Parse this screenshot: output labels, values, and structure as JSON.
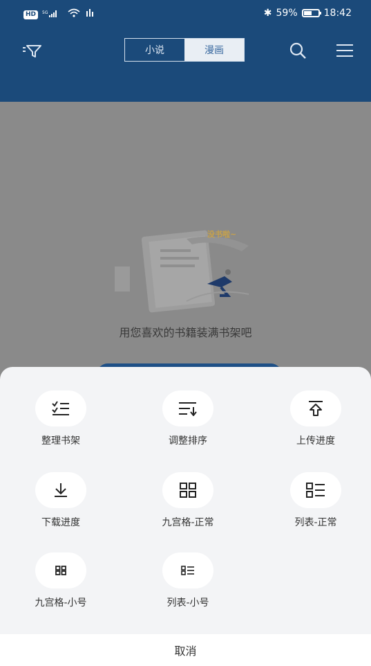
{
  "status_bar": {
    "network_badge": "HD",
    "signal_text": "5G",
    "bluetooth": "✱",
    "battery_percent": "59%",
    "battery_level": 0.59,
    "time": "18:42"
  },
  "header": {
    "tabs": [
      {
        "label": "小说",
        "selected": false
      },
      {
        "label": "漫画",
        "selected": true
      }
    ]
  },
  "empty_state": {
    "bubble_text": "没书啦~",
    "message": "用您喜欢的书籍装满书架吧"
  },
  "menu": {
    "items": [
      {
        "label": "整理书架",
        "icon": "checklist-icon"
      },
      {
        "label": "调整排序",
        "icon": "sort-icon"
      },
      {
        "label": "上传进度",
        "icon": "upload-icon"
      },
      {
        "label": "下载进度",
        "icon": "download-icon"
      },
      {
        "label": "九宫格-正常",
        "icon": "grid-icon"
      },
      {
        "label": "列表-正常",
        "icon": "list-icon"
      },
      {
        "label": "九宫格-小号",
        "icon": "grid-small-icon"
      },
      {
        "label": "列表-小号",
        "icon": "list-small-icon"
      }
    ],
    "cancel_label": "取消"
  },
  "colors": {
    "header_bg": "#1b4a7a",
    "sheet_bg": "#f3f4f6",
    "accent": "#3b6aa0"
  }
}
